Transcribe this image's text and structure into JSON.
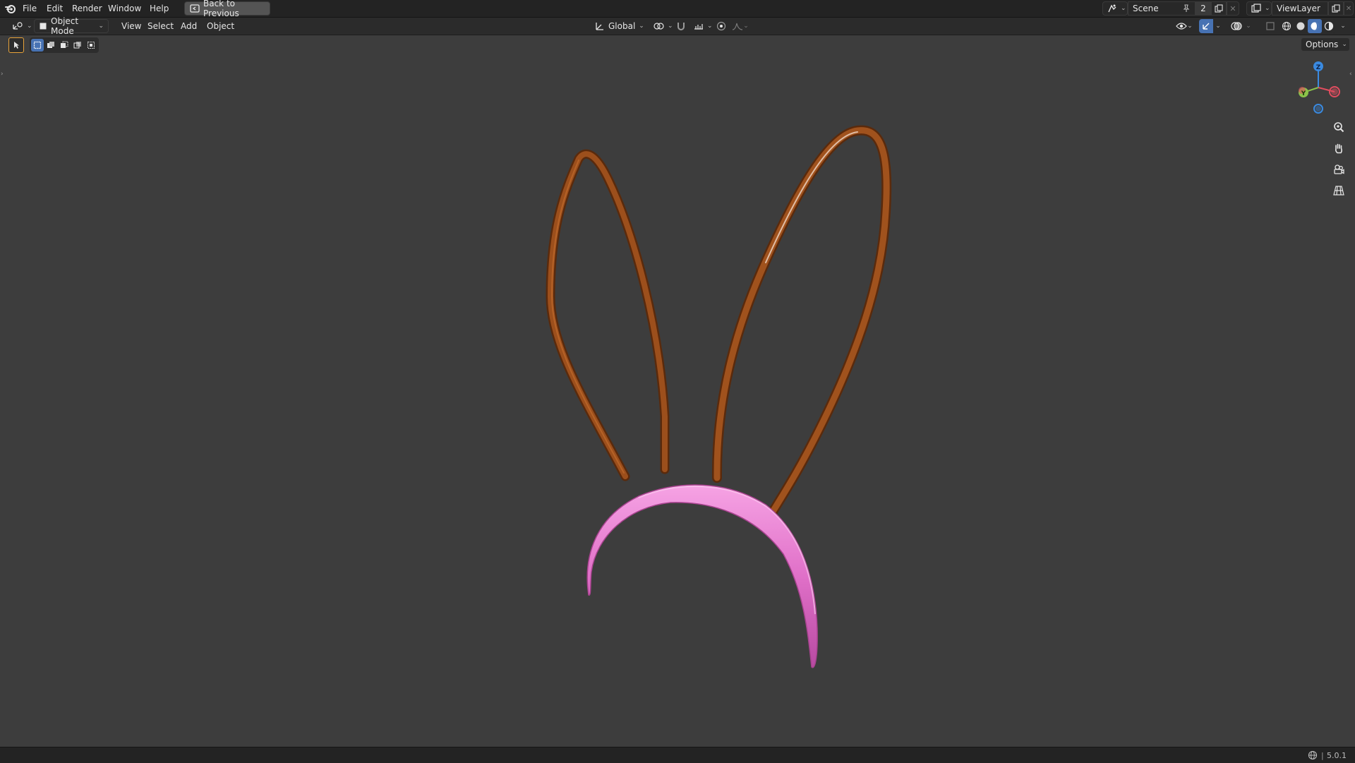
{
  "menubar": {
    "items": [
      "File",
      "Edit",
      "Render",
      "Window",
      "Help"
    ],
    "back_button": "Back to Previous"
  },
  "scene": {
    "label": "Scene",
    "users_count": "2"
  },
  "view_layer": {
    "label": "ViewLayer"
  },
  "header": {
    "mode": "Object Mode",
    "menus": [
      "View",
      "Select",
      "Add",
      "Object"
    ],
    "transform_orientation": "Global"
  },
  "viewport": {
    "options_label": "Options",
    "gizmo": {
      "z": "Z",
      "y": "Y"
    },
    "object_colors": {
      "ears": "#8a4418",
      "headband": "#e070c8"
    }
  },
  "status": {
    "version": "5.0.1"
  },
  "colors": {
    "accent": "#4772b3",
    "gizmo_x": "#e24d5f",
    "gizmo_y": "#8bc34a",
    "gizmo_z": "#3a8ae0"
  }
}
